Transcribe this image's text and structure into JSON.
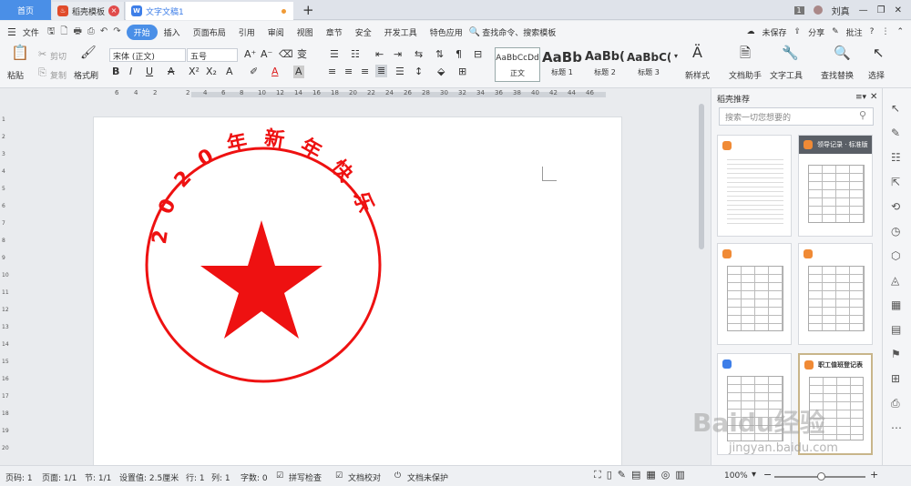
{
  "tabs": {
    "home": "首页",
    "template": "稻壳模板",
    "doc": "文字文稿1",
    "new_tab": "+"
  },
  "window": {
    "badge": "1",
    "user": "刘真"
  },
  "menu": {
    "file": "文件",
    "items": [
      "开始",
      "插入",
      "页面布局",
      "引用",
      "审阅",
      "视图",
      "章节",
      "安全",
      "开发工具",
      "特色应用"
    ],
    "search": "查找命令、搜索模板",
    "unsaved": "未保存",
    "share": "分享",
    "annotate": "批注",
    "help": "?"
  },
  "ribbon": {
    "paste": "粘贴",
    "cut": "剪切",
    "copy": "复制",
    "format_painter": "格式刷",
    "font_name": "宋体 (正文)",
    "font_size": "五号",
    "styles": [
      {
        "preview": "AaBbCcDd",
        "name": "正文"
      },
      {
        "preview": "AaBb",
        "name": "标题 1"
      },
      {
        "preview": "AaBb(",
        "name": "标题 2"
      },
      {
        "preview": "AaBbC(",
        "name": "标题 3"
      }
    ],
    "new_style": "新样式",
    "doc_helper": "文档助手",
    "text_tools": "文字工具",
    "find_replace": "查找替换",
    "select": "选择"
  },
  "ruler": {
    "marks": [
      "6",
      "4",
      "2",
      "2",
      "4",
      "6",
      "8",
      "10",
      "12",
      "14",
      "16",
      "18",
      "20",
      "22",
      "24",
      "26",
      "28",
      "30",
      "32",
      "34",
      "36",
      "38",
      "40",
      "42",
      "44",
      "46"
    ]
  },
  "vruler": [
    "1",
    "2",
    "3",
    "4",
    "5",
    "6",
    "7",
    "8",
    "9",
    "10",
    "11",
    "12",
    "13",
    "14",
    "15",
    "16",
    "17",
    "18",
    "19",
    "20"
  ],
  "document": {
    "stamp_text": "2020年新年快乐",
    "stamp_color": "#ee1111"
  },
  "panel": {
    "title": "稻壳推荐",
    "search_placeholder": "搜索一切您想要的",
    "featured_label": "领导记录 · 标准版",
    "card_title": "职工值班登记表"
  },
  "status": {
    "page_code": "页码: 1",
    "pages": "页面: 1/1",
    "section": "节: 1/1",
    "position": "设置值: 2.5厘米",
    "row": "行: 1",
    "col": "列: 1",
    "words": "字数: 0",
    "spell": "拼写检查",
    "proof": "文档校对",
    "protect": "文档未保护",
    "zoom": "100%"
  },
  "watermark": {
    "brand": "Baidu经验",
    "url": "jingyan.baidu.com"
  }
}
